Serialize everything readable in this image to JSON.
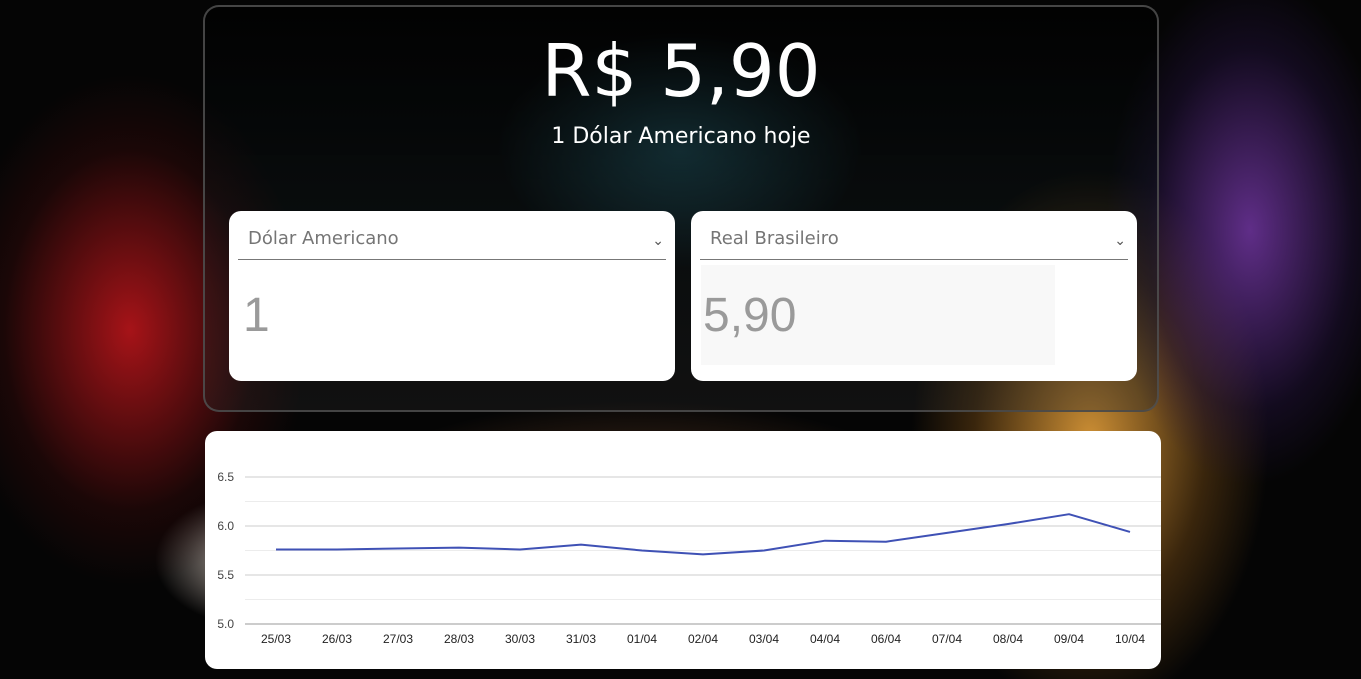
{
  "header": {
    "rate": "R$ 5,90",
    "subtitle": "1 Dólar Americano hoje"
  },
  "converter": {
    "from": {
      "currency": "Dólar Americano",
      "amount": "1",
      "chevron_icon": "chevron-down-icon"
    },
    "to": {
      "currency": "Real Brasileiro",
      "amount": "5,90",
      "chevron_icon": "chevron-down-icon"
    }
  },
  "chart_data": {
    "type": "line",
    "categories": [
      "25/03",
      "26/03",
      "27/03",
      "28/03",
      "30/03",
      "31/03",
      "01/04",
      "02/04",
      "03/04",
      "04/04",
      "06/04",
      "07/04",
      "08/04",
      "09/04",
      "10/04"
    ],
    "series": [
      {
        "values": [
          5.76,
          5.76,
          5.77,
          5.78,
          5.76,
          5.81,
          5.75,
          5.71,
          5.75,
          5.85,
          5.84,
          5.93,
          6.02,
          6.12,
          5.94
        ],
        "color": "#3f51b5"
      }
    ],
    "yticks": [
      "6.5",
      "6.0",
      "5.5",
      "5.0"
    ],
    "ylim": [
      5.0,
      6.5
    ],
    "grid": true
  }
}
